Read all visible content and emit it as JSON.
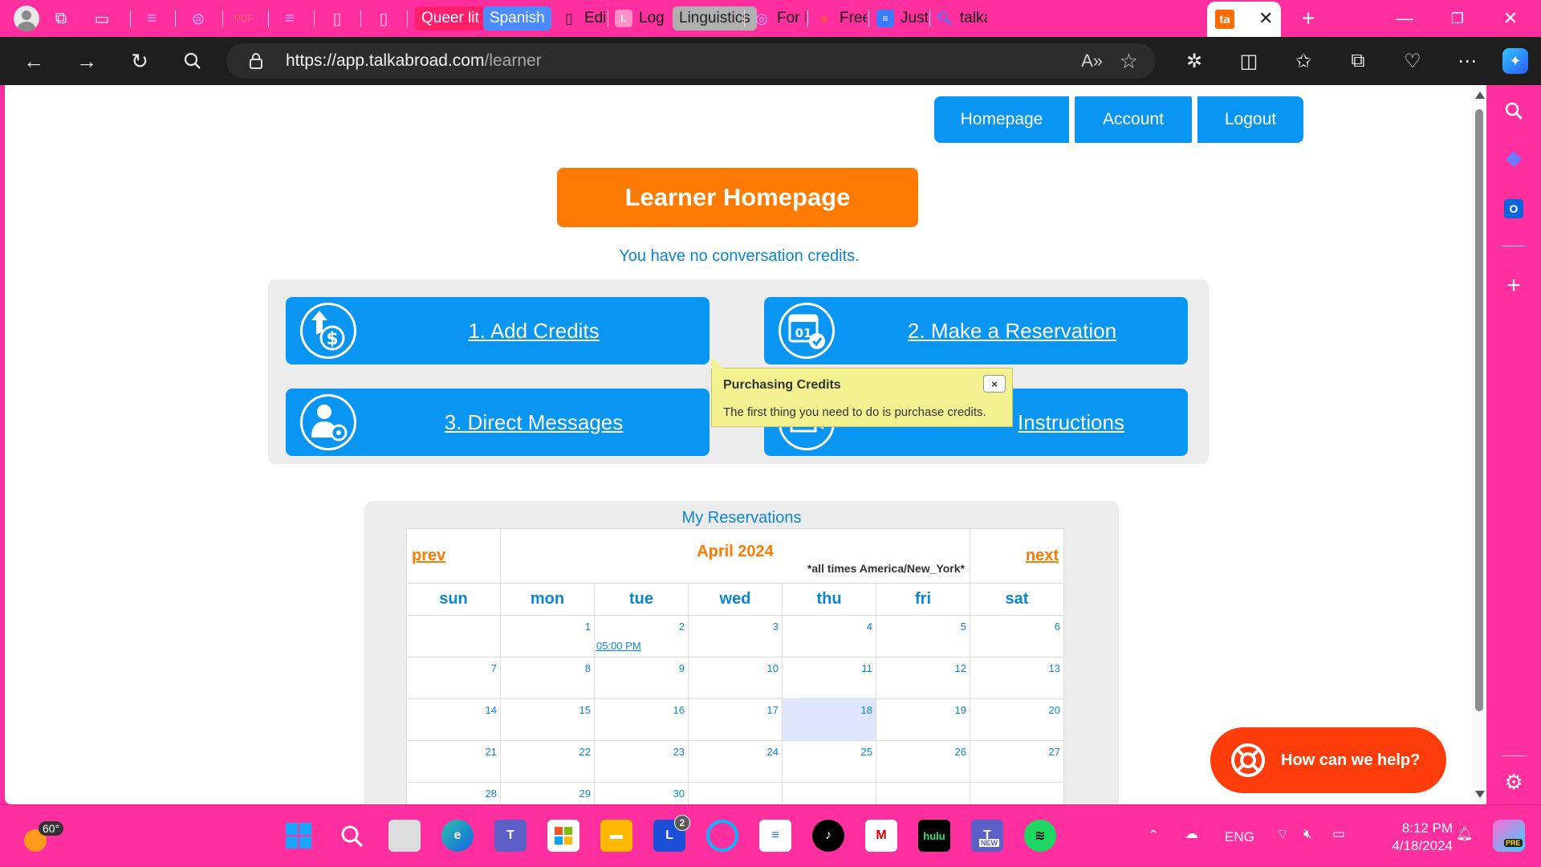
{
  "browser": {
    "tabs": [
      {
        "label": "Queer lit",
        "bg": "#ff1f6a"
      },
      {
        "label": "Spanish",
        "bg": "#4a8cff"
      },
      {
        "label": "Edit F",
        "bg": ""
      },
      {
        "label": "Login",
        "bg": ""
      },
      {
        "label": "Linguistics",
        "bg": "#b0b0b0"
      },
      {
        "label": "For P",
        "bg": ""
      },
      {
        "label": "Freec",
        "bg": ""
      },
      {
        "label": "Justif",
        "bg": ""
      },
      {
        "label": "talka",
        "bg": ""
      }
    ],
    "active_tab_favicon": "ta",
    "url_host": "https://app.talkabroad.com",
    "url_path": "/learner",
    "accent": "#ff2fa0"
  },
  "nav": {
    "homepage": "Homepage",
    "account": "Account",
    "logout": "Logout"
  },
  "page": {
    "title": "Learner Homepage",
    "credit_message": "You have no conversation credits.",
    "actions": [
      {
        "label": "1. Add Credits",
        "icon": "dollar-up-icon"
      },
      {
        "label": "2. Make a Reservation",
        "icon": "calendar-check-icon"
      },
      {
        "label": "3. Direct Messages",
        "icon": "user-gear-icon"
      },
      {
        "label": "Instructions",
        "icon": "video-icon"
      }
    ],
    "tooltip": {
      "title": "Purchasing Credits",
      "body": "The first thing you need to do is purchase credits.",
      "close": "×"
    },
    "colors": {
      "primary": "#0896f2",
      "accent": "#ff7a00",
      "help": "#ff3d0a"
    }
  },
  "calendar": {
    "caption": "My Reservations",
    "prev": "prev",
    "next": "next",
    "month": "April 2024",
    "timezone_note": "*all times America/New_York*",
    "weekdays": [
      "sun",
      "mon",
      "tue",
      "wed",
      "thu",
      "fri",
      "sat"
    ],
    "weeks": [
      [
        "",
        "1",
        "2",
        "3",
        "4",
        "5",
        "6"
      ],
      [
        "7",
        "8",
        "9",
        "10",
        "11",
        "12",
        "13"
      ],
      [
        "14",
        "15",
        "16",
        "17",
        "18",
        "19",
        "20"
      ],
      [
        "21",
        "22",
        "23",
        "24",
        "25",
        "26",
        "27"
      ],
      [
        "28",
        "29",
        "30",
        "",
        "",
        "",
        ""
      ]
    ],
    "today": "18",
    "appointment": {
      "day": "2",
      "time": "05:00 PM"
    }
  },
  "help": {
    "label": "How can we help?"
  },
  "taskbar": {
    "weather_temp": "60°",
    "teams_badge": "2",
    "new_badge": "NEW",
    "hulu": "hulu",
    "lang": "ENG",
    "time": "8:12 PM",
    "date": "4/18/2024",
    "pre_badge": "PRE"
  }
}
